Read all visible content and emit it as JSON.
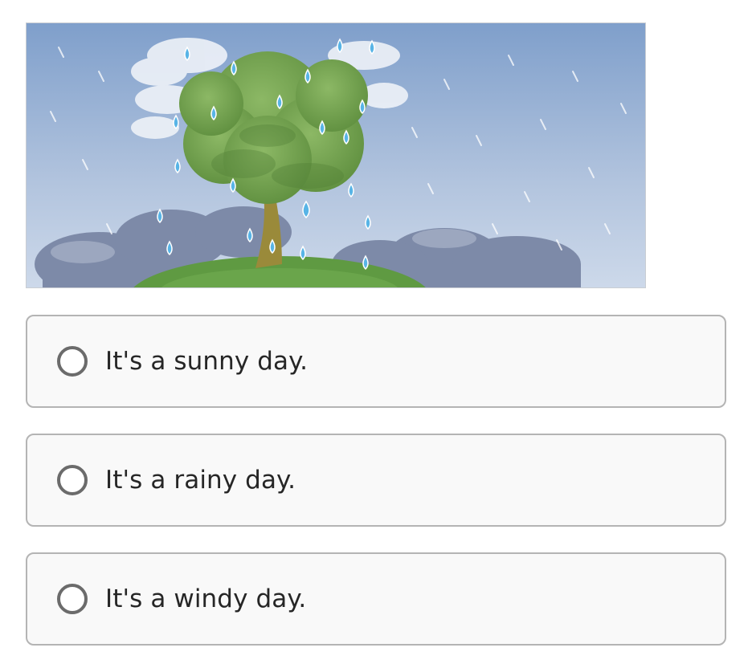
{
  "question": {
    "image": {
      "icon": "rainy-tree-illustration",
      "colors": {
        "sky_top": "#7f9fcb",
        "sky_bottom": "#cdd9ea",
        "cloud": "#7d8aa8",
        "foliage": "#6f9e4c",
        "trunk": "#9a8a3a",
        "hill": "#5f9a42",
        "raindrop": "#58b4e6"
      }
    },
    "options": [
      {
        "label": "It's a sunny day.",
        "selected": false
      },
      {
        "label": "It's a rainy day.",
        "selected": false
      },
      {
        "label": "It's a windy day.",
        "selected": false
      }
    ]
  }
}
